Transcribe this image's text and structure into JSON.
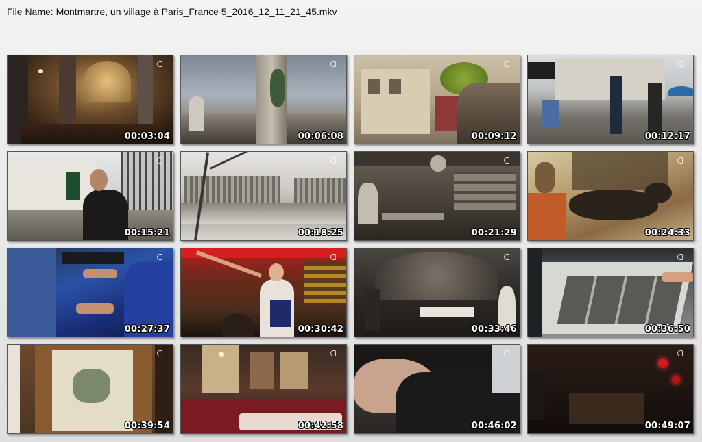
{
  "header": {
    "file_name_text": "File Name: Montmartre, un village à Paris_France 5_2016_12_11_21_45.mkv"
  },
  "thumbnails": [
    {
      "timestamp": "00:03:04"
    },
    {
      "timestamp": "00:06:08"
    },
    {
      "timestamp": "00:09:12"
    },
    {
      "timestamp": "00:12:17"
    },
    {
      "timestamp": "00:15:21"
    },
    {
      "timestamp": "00:18:25"
    },
    {
      "timestamp": "00:21:29"
    },
    {
      "timestamp": "00:24:33"
    },
    {
      "timestamp": "00:27:37"
    },
    {
      "timestamp": "00:30:42"
    },
    {
      "timestamp": "00:33:46"
    },
    {
      "timestamp": "00:36:50"
    },
    {
      "timestamp": "00:39:54"
    },
    {
      "timestamp": "00:42:58"
    },
    {
      "timestamp": "00:46:02"
    },
    {
      "timestamp": "00:49:07"
    }
  ]
}
